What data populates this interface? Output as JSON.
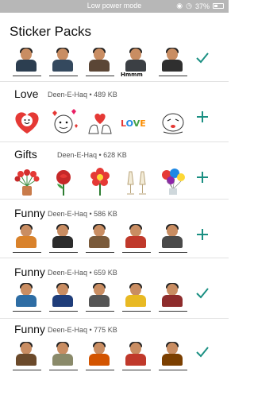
{
  "status_bar": {
    "mode": "Low power mode",
    "battery": "37%"
  },
  "page_title": "Sticker Packs",
  "packs": [
    {
      "name": "",
      "meta": "",
      "action": "added",
      "stickers": [
        {
          "kind": "person",
          "body": "#2c3e50",
          "caption": true
        },
        {
          "kind": "person",
          "body": "#34495e",
          "caption": true
        },
        {
          "kind": "person",
          "body": "#5b4636",
          "caption": true
        },
        {
          "kind": "person",
          "body": "#3b3f44",
          "label": "Hmmm"
        },
        {
          "kind": "person",
          "body": "#2f2f2f",
          "caption": true
        }
      ]
    },
    {
      "name": "Love",
      "meta": "Deen-E-Haq • 489 KB",
      "action": "add",
      "stickers": [
        {
          "kind": "heart-face",
          "label": ""
        },
        {
          "kind": "doodle-love",
          "label": ""
        },
        {
          "kind": "hands-heart",
          "label": ""
        },
        {
          "kind": "love-text",
          "label": "LOVE"
        },
        {
          "kind": "doodle-face",
          "label": ""
        }
      ]
    },
    {
      "name": "Gifts",
      "meta": "Deen-E-Haq • 628 KB",
      "action": "add",
      "stickers": [
        {
          "kind": "tulips",
          "label": ""
        },
        {
          "kind": "rose",
          "label": ""
        },
        {
          "kind": "flower",
          "label": ""
        },
        {
          "kind": "glasses",
          "label": ""
        },
        {
          "kind": "balloons",
          "label": ""
        }
      ]
    },
    {
      "name": "Funny",
      "meta": "Deen-E-Haq • 586 KB",
      "action": "add",
      "stickers": [
        {
          "kind": "person",
          "body": "#d9822b",
          "caption": true
        },
        {
          "kind": "person",
          "body": "#2c2c2c",
          "caption": true
        },
        {
          "kind": "person",
          "body": "#7a5a3a",
          "caption": true
        },
        {
          "kind": "person",
          "body": "#c0392b",
          "caption": true
        },
        {
          "kind": "person",
          "body": "#4a4a4a",
          "caption": true
        }
      ]
    },
    {
      "name": "Funny",
      "meta": "Deen-E-Haq • 659 KB",
      "action": "added",
      "stickers": [
        {
          "kind": "person",
          "body": "#2e6da4",
          "caption": true
        },
        {
          "kind": "person",
          "body": "#1f3d7a",
          "caption": true
        },
        {
          "kind": "person",
          "body": "#555555",
          "caption": true
        },
        {
          "kind": "person",
          "body": "#e8b923",
          "caption": true
        },
        {
          "kind": "person",
          "body": "#8e2c2c",
          "caption": true
        }
      ]
    },
    {
      "name": "Funny",
      "meta": "Deen-E-Haq • 775 KB",
      "action": "added",
      "stickers": [
        {
          "kind": "person",
          "body": "#6b4a2b",
          "caption": true
        },
        {
          "kind": "person",
          "body": "#8a8a6a",
          "caption": true
        },
        {
          "kind": "person",
          "body": "#d35400",
          "caption": true
        },
        {
          "kind": "person",
          "body": "#c0392b",
          "caption": true
        },
        {
          "kind": "person",
          "body": "#7b3f00",
          "caption": true
        }
      ]
    }
  ],
  "colors": {
    "accent": "#1a8f82",
    "divider": "#e2e2e2",
    "status_bar": "#b7b7b7"
  },
  "icons": {
    "add": "plus-icon",
    "added": "check-icon"
  }
}
